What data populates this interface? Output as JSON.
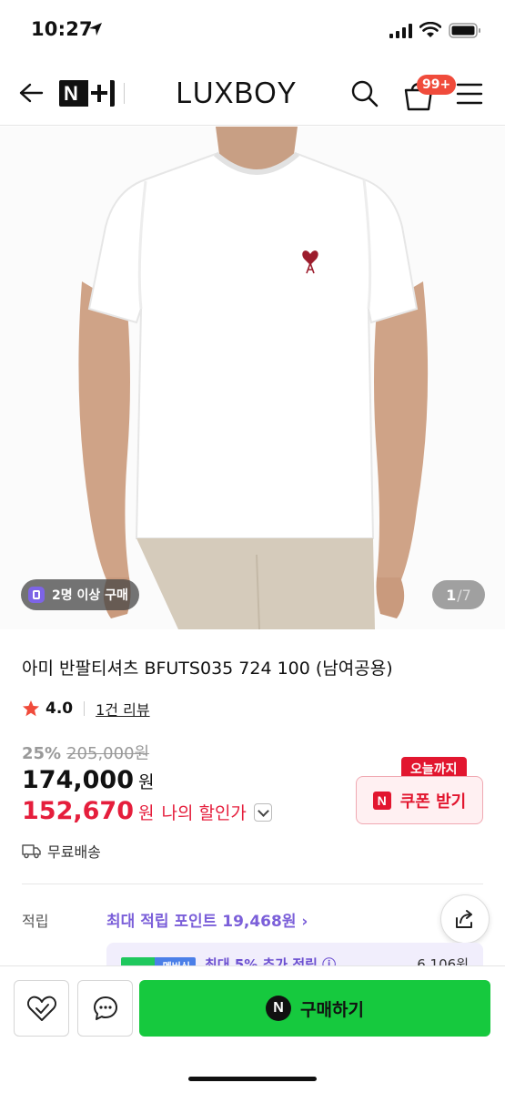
{
  "status": {
    "time": "10:27"
  },
  "header": {
    "brand": "LUXBOY",
    "cart_badge": "99+",
    "nplus_letter": "N"
  },
  "gallery": {
    "badge": "2명 이상 구매",
    "current": "1",
    "total": "/7"
  },
  "product": {
    "title": "아미 반팔티셔츠 BFUTS035 724 100 (남여공용)",
    "rating": "4.0",
    "review_link": "1건 리뷰",
    "discount_rate": "25%",
    "original_price": "205,000원",
    "price": "174,000",
    "price_unit": "원",
    "my_price": "152,670",
    "my_price_unit": "원",
    "my_price_label": "나의 할인가",
    "shipping": "무료배송"
  },
  "coupon": {
    "tag": "오늘까지",
    "logo": "N",
    "label": "쿠폰 받기"
  },
  "points": {
    "label": "적립",
    "value": "최대 적립 포인트 19,468원 ›",
    "membership_tag": "멤버십",
    "membership_text": "최대 5% 추가 적립 ⓘ",
    "membership_amount": "6,106원"
  },
  "bottom": {
    "buy_logo": "N",
    "buy_label": "구매하기"
  },
  "colors": {
    "accent_green": "#16c93e",
    "price_red": "#e51e3c",
    "points_purple": "#7b5fd9"
  }
}
